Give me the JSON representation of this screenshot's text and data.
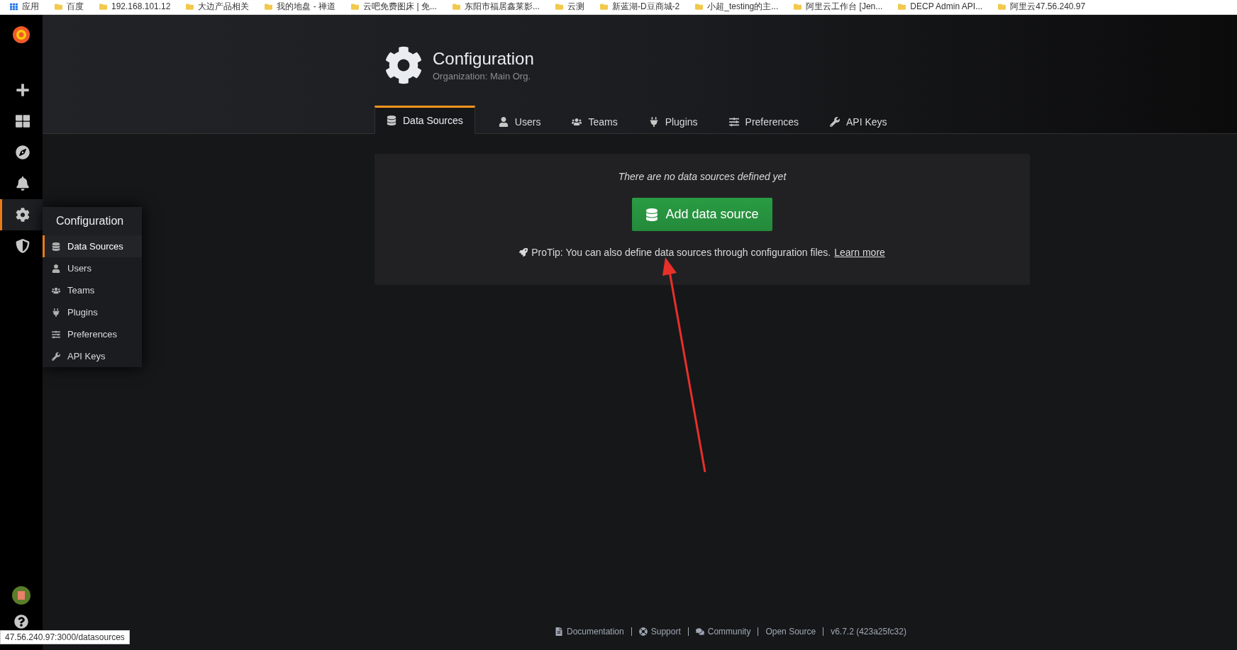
{
  "bookmarks": [
    {
      "label": "应用"
    },
    {
      "label": "百度"
    },
    {
      "label": "192.168.101.12"
    },
    {
      "label": "大边产品相关"
    },
    {
      "label": "我的地盘 - 禅道"
    },
    {
      "label": "云吧免费图床 | 免..."
    },
    {
      "label": "东阳市福居鑫莱影..."
    },
    {
      "label": "云测"
    },
    {
      "label": "新蓝湖-D豆商城-2"
    },
    {
      "label": "小超_testing的主..."
    },
    {
      "label": "阿里云工作台 [Jen..."
    },
    {
      "label": "DECP Admin API..."
    },
    {
      "label": "阿里云47.56.240.97"
    }
  ],
  "sidebar": {
    "items": [
      {
        "selected": false
      },
      {
        "selected": false
      },
      {
        "selected": false
      },
      {
        "selected": false
      },
      {
        "selected": true
      },
      {
        "selected": false
      }
    ]
  },
  "submenu": {
    "title": "Configuration",
    "items": [
      {
        "label": "Data Sources",
        "selected": true
      },
      {
        "label": "Users",
        "selected": false
      },
      {
        "label": "Teams",
        "selected": false
      },
      {
        "label": "Plugins",
        "selected": false
      },
      {
        "label": "Preferences",
        "selected": false
      },
      {
        "label": "API Keys",
        "selected": false
      }
    ]
  },
  "header": {
    "title": "Configuration",
    "subtitle": "Organization: Main Org."
  },
  "tabs": [
    {
      "label": "Data Sources",
      "selected": true
    },
    {
      "label": "Users",
      "selected": false
    },
    {
      "label": "Teams",
      "selected": false
    },
    {
      "label": "Plugins",
      "selected": false
    },
    {
      "label": "Preferences",
      "selected": false
    },
    {
      "label": "API Keys",
      "selected": false
    }
  ],
  "panel": {
    "message": "There are no data sources defined yet",
    "button": "Add data source",
    "protip": "ProTip: You can also define data sources through configuration files.",
    "link": "Learn more"
  },
  "footer": {
    "links": [
      "Documentation",
      "Support",
      "Community",
      "Open Source",
      "v6.7.2 (423a25fc32)"
    ]
  },
  "status_url": "47.56.240.97:3000/datasources"
}
